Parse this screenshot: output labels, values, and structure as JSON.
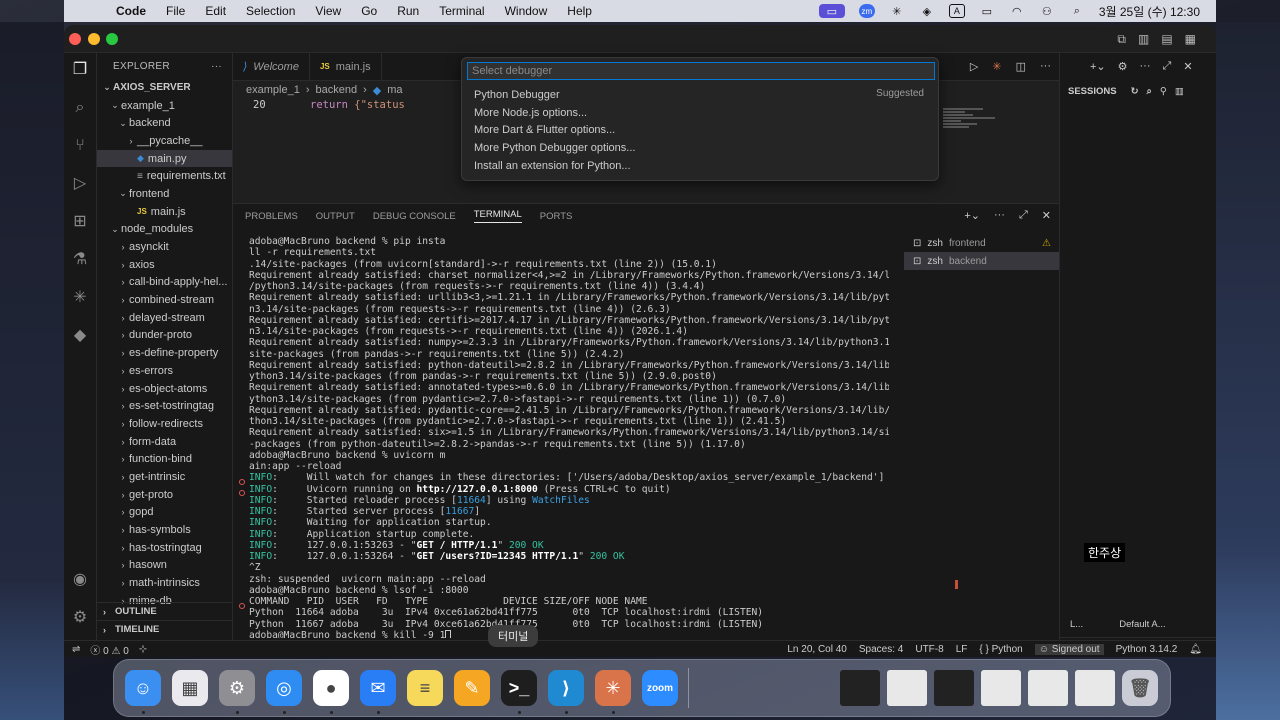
{
  "menubar": {
    "app": "Code",
    "items": [
      "File",
      "Edit",
      "Selection",
      "View",
      "Go",
      "Run",
      "Terminal",
      "Window",
      "Help"
    ],
    "datetime": "3월 25일 (수) 12:30",
    "zoom_badge": "zm",
    "input_badge": "A"
  },
  "sidebar": {
    "title": "EXPLORER",
    "root": "AXIOS_SERVER",
    "tree": [
      {
        "label": "example_1",
        "depth": 1,
        "type": "folder-open"
      },
      {
        "label": "backend",
        "depth": 2,
        "type": "folder-open"
      },
      {
        "label": "__pycache__",
        "depth": 3,
        "type": "folder-closed"
      },
      {
        "label": "main.py",
        "depth": 3,
        "type": "py",
        "selected": true
      },
      {
        "label": "requirements.txt",
        "depth": 3,
        "type": "txt"
      },
      {
        "label": "frontend",
        "depth": 2,
        "type": "folder-open"
      },
      {
        "label": "main.js",
        "depth": 3,
        "type": "js"
      },
      {
        "label": "node_modules",
        "depth": 1,
        "type": "folder-open"
      },
      {
        "label": "asynckit",
        "depth": 2,
        "type": "folder-closed"
      },
      {
        "label": "axios",
        "depth": 2,
        "type": "folder-closed"
      },
      {
        "label": "call-bind-apply-hel...",
        "depth": 2,
        "type": "folder-closed"
      },
      {
        "label": "combined-stream",
        "depth": 2,
        "type": "folder-closed"
      },
      {
        "label": "delayed-stream",
        "depth": 2,
        "type": "folder-closed"
      },
      {
        "label": "dunder-proto",
        "depth": 2,
        "type": "folder-closed"
      },
      {
        "label": "es-define-property",
        "depth": 2,
        "type": "folder-closed"
      },
      {
        "label": "es-errors",
        "depth": 2,
        "type": "folder-closed"
      },
      {
        "label": "es-object-atoms",
        "depth": 2,
        "type": "folder-closed"
      },
      {
        "label": "es-set-tostringtag",
        "depth": 2,
        "type": "folder-closed"
      },
      {
        "label": "follow-redirects",
        "depth": 2,
        "type": "folder-closed"
      },
      {
        "label": "form-data",
        "depth": 2,
        "type": "folder-closed"
      },
      {
        "label": "function-bind",
        "depth": 2,
        "type": "folder-closed"
      },
      {
        "label": "get-intrinsic",
        "depth": 2,
        "type": "folder-closed"
      },
      {
        "label": "get-proto",
        "depth": 2,
        "type": "folder-closed"
      },
      {
        "label": "gopd",
        "depth": 2,
        "type": "folder-closed"
      },
      {
        "label": "has-symbols",
        "depth": 2,
        "type": "folder-closed"
      },
      {
        "label": "has-tostringtag",
        "depth": 2,
        "type": "folder-closed"
      },
      {
        "label": "hasown",
        "depth": 2,
        "type": "folder-closed"
      },
      {
        "label": "math-intrinsics",
        "depth": 2,
        "type": "folder-closed"
      },
      {
        "label": "mime-db",
        "depth": 2,
        "type": "folder-closed"
      }
    ],
    "outline": "OUTLINE",
    "timeline": "TIMELINE"
  },
  "tabs": [
    {
      "label": "Welcome",
      "icon": "vscode-icon",
      "italic": true
    },
    {
      "label": "main.js",
      "icon": "js-icon",
      "italic": false
    }
  ],
  "breadcrumb": [
    "example_1",
    "backend",
    "ma"
  ],
  "code": {
    "line_number": "20",
    "keyword": "return",
    "rest": " {\"status"
  },
  "quick_pick": {
    "placeholder": "Select debugger",
    "items": [
      {
        "label": "Python Debugger",
        "badge": "Suggested"
      },
      {
        "label": "More Node.js options..."
      },
      {
        "label": "More Dart & Flutter options..."
      },
      {
        "label": "More Python Debugger options..."
      },
      {
        "label": "Install an extension for Python..."
      }
    ]
  },
  "panel": {
    "tabs": [
      "PROBLEMS",
      "OUTPUT",
      "DEBUG CONSOLE",
      "TERMINAL",
      "PORTS"
    ],
    "active_tab": "TERMINAL",
    "terminals": [
      {
        "shell": "zsh",
        "name": "frontend",
        "warning": true
      },
      {
        "shell": "zsh",
        "name": "backend",
        "selected": true
      }
    ]
  },
  "terminal_lines": [
    {
      "segs": [
        [
          "adoba@MacBruno backend % pip insta",
          "n"
        ]
      ]
    },
    {
      "segs": [
        [
          "ll -r requirements.txt",
          "n"
        ]
      ]
    },
    {
      "segs": [
        [
          ".14/site-packages (from uvicorn[standard]->-r requirements.txt (line 2)) (15.0.1)",
          "n"
        ]
      ]
    },
    {
      "segs": [
        [
          "Requirement already satisfied: charset_normalizer<4,>=2 in /Library/Frameworks/Python.framework/Versions/3.14/lib",
          "n"
        ]
      ]
    },
    {
      "segs": [
        [
          "/python3.14/site-packages (from requests->-r requirements.txt (line 4)) (3.4.4)",
          "n"
        ]
      ]
    },
    {
      "segs": [
        [
          "Requirement already satisfied: urllib3<3,>=1.21.1 in /Library/Frameworks/Python.framework/Versions/3.14/lib/pytho",
          "n"
        ]
      ]
    },
    {
      "segs": [
        [
          "n3.14/site-packages (from requests->-r requirements.txt (line 4)) (2.6.3)",
          "n"
        ]
      ]
    },
    {
      "segs": [
        [
          "Requirement already satisfied: certifi>=2017.4.17 in /Library/Frameworks/Python.framework/Versions/3.14/lib/pytho",
          "n"
        ]
      ]
    },
    {
      "segs": [
        [
          "n3.14/site-packages (from requests->-r requirements.txt (line 4)) (2026.1.4)",
          "n"
        ]
      ]
    },
    {
      "segs": [
        [
          "Requirement already satisfied: numpy>=2.3.3 in /Library/Frameworks/Python.framework/Versions/3.14/lib/python3.14/",
          "n"
        ]
      ]
    },
    {
      "segs": [
        [
          "site-packages (from pandas->-r requirements.txt (line 5)) (2.4.2)",
          "n"
        ]
      ]
    },
    {
      "segs": [
        [
          "Requirement already satisfied: python-dateutil>=2.8.2 in /Library/Frameworks/Python.framework/Versions/3.14/lib/p",
          "n"
        ]
      ]
    },
    {
      "segs": [
        [
          "ython3.14/site-packages (from pandas->-r requirements.txt (line 5)) (2.9.0.post0)",
          "n"
        ]
      ]
    },
    {
      "segs": [
        [
          "Requirement already satisfied: annotated-types>=0.6.0 in /Library/Frameworks/Python.framework/Versions/3.14/lib/p",
          "n"
        ]
      ]
    },
    {
      "segs": [
        [
          "ython3.14/site-packages (from pydantic>=2.7.0->fastapi->-r requirements.txt (line 1)) (0.7.0)",
          "n"
        ]
      ]
    },
    {
      "segs": [
        [
          "Requirement already satisfied: pydantic-core==2.41.5 in /Library/Frameworks/Python.framework/Versions/3.14/lib/py",
          "n"
        ]
      ]
    },
    {
      "segs": [
        [
          "thon3.14/site-packages (from pydantic>=2.7.0->fastapi->-r requirements.txt (line 1)) (2.41.5)",
          "n"
        ]
      ]
    },
    {
      "segs": [
        [
          "Requirement already satisfied: six>=1.5 in /Library/Frameworks/Python.framework/Versions/3.14/lib/python3.14/site",
          "n"
        ]
      ]
    },
    {
      "segs": [
        [
          "-packages (from python-dateutil>=2.8.2->pandas->-r requirements.txt (line 5)) (1.17.0)",
          "n"
        ]
      ]
    },
    {
      "segs": [
        [
          "adoba@MacBruno backend % uvicorn m",
          "n"
        ]
      ]
    },
    {
      "segs": [
        [
          "ain:app --reload",
          "n"
        ]
      ]
    },
    {
      "segs": [
        [
          "INFO",
          "g"
        ],
        [
          ":     Will watch for changes in these directories: ['/Users/adoba/Desktop/axios_server/example_1/backend']",
          "n"
        ]
      ]
    },
    {
      "segs": [
        [
          "INFO",
          "g"
        ],
        [
          ":     Uvicorn running on ",
          "n"
        ],
        [
          "http://127.0.0.1:8000",
          "w"
        ],
        [
          " (Press CTRL+C to quit)",
          "n"
        ]
      ]
    },
    {
      "segs": [
        [
          "INFO",
          "g"
        ],
        [
          ":     Started reloader process [",
          "n"
        ],
        [
          "11664",
          "c"
        ],
        [
          "] using ",
          "n"
        ],
        [
          "WatchFiles",
          "c"
        ]
      ]
    },
    {
      "segs": [
        [
          "INFO",
          "g"
        ],
        [
          ":     Started server process [",
          "n"
        ],
        [
          "11667",
          "c"
        ],
        [
          "]",
          "n"
        ]
      ]
    },
    {
      "segs": [
        [
          "INFO",
          "g"
        ],
        [
          ":     Waiting for application startup.",
          "n"
        ]
      ]
    },
    {
      "segs": [
        [
          "INFO",
          "g"
        ],
        [
          ":     Application startup complete.",
          "n"
        ]
      ]
    },
    {
      "segs": [
        [
          "INFO",
          "g"
        ],
        [
          ":     127.0.0.1:53263 - \"",
          "n"
        ],
        [
          "GET / HTTP/1.1",
          "w"
        ],
        [
          "\" ",
          "n"
        ],
        [
          "200 OK",
          "g"
        ]
      ]
    },
    {
      "segs": [
        [
          "INFO",
          "g"
        ],
        [
          ":     127.0.0.1:53264 - \"",
          "n"
        ],
        [
          "GET /users?ID=12345 HTTP/1.1",
          "w"
        ],
        [
          "\" ",
          "n"
        ],
        [
          "200 OK",
          "g"
        ]
      ]
    },
    {
      "segs": [
        [
          "^Z",
          "n"
        ]
      ]
    },
    {
      "segs": [
        [
          "zsh: suspended  uvicorn main:app --reload",
          "n"
        ]
      ]
    },
    {
      "segs": [
        [
          "adoba@MacBruno backend % lsof -i :8000",
          "n"
        ]
      ]
    },
    {
      "segs": [
        [
          "COMMAND   PID  USER   FD   TYPE             DEVICE SIZE/OFF NODE NAME",
          "n"
        ]
      ]
    },
    {
      "segs": [
        [
          "Python  11664 adoba    3u  IPv4 0xce61a62bd41ff775      0t0  TCP localhost:irdmi (LISTEN)",
          "n"
        ]
      ]
    },
    {
      "segs": [
        [
          "Python  11667 adoba    3u  IPv4 0xce61a62bd41ff775      0t0  TCP localhost:irdmi (LISTEN)",
          "n"
        ]
      ]
    },
    {
      "segs": [
        [
          "adoba@MacBruno backend % kill -9 1",
          "n"
        ]
      ]
    }
  ],
  "right_panel": {
    "title": "SESSIONS",
    "footer_left": "L...",
    "footer_right": "Default A..."
  },
  "statusbar": {
    "errors": "0",
    "warnings": "0",
    "position": "Ln 20, Col 40",
    "spaces": "Spaces: 4",
    "encoding": "UTF-8",
    "eol": "LF",
    "language": "Python",
    "account": "Signed out",
    "interpreter": "Python 3.14.2"
  },
  "caption": "한주상",
  "dock_tooltip": "터미널",
  "dock": [
    {
      "name": "finder-icon",
      "color": "#3a8ff0",
      "glyph": "☺"
    },
    {
      "name": "launchpad-icon",
      "color": "#e9e9ee",
      "glyph": "▦"
    },
    {
      "name": "system-settings-icon",
      "color": "#8e8e93",
      "glyph": "⚙"
    },
    {
      "name": "safari-icon",
      "color": "#2f8cf2",
      "glyph": "◎"
    },
    {
      "name": "chrome-icon",
      "color": "#ffffff",
      "glyph": "●"
    },
    {
      "name": "mail-icon",
      "color": "#2a7ef5",
      "glyph": "✉"
    },
    {
      "name": "notes-icon",
      "color": "#f6d95a",
      "glyph": "≡"
    },
    {
      "name": "pages-icon",
      "color": "#f5a623",
      "glyph": "✎"
    },
    {
      "name": "terminal-icon",
      "color": "#1e1e1e",
      "glyph": ">_"
    },
    {
      "name": "vscode-icon",
      "color": "#1f8ad2",
      "glyph": "⟩"
    },
    {
      "name": "claude-icon",
      "color": "#d9744a",
      "glyph": "✳"
    },
    {
      "name": "zoom-icon",
      "color": "#2d8cff",
      "glyph": "zoom"
    }
  ]
}
